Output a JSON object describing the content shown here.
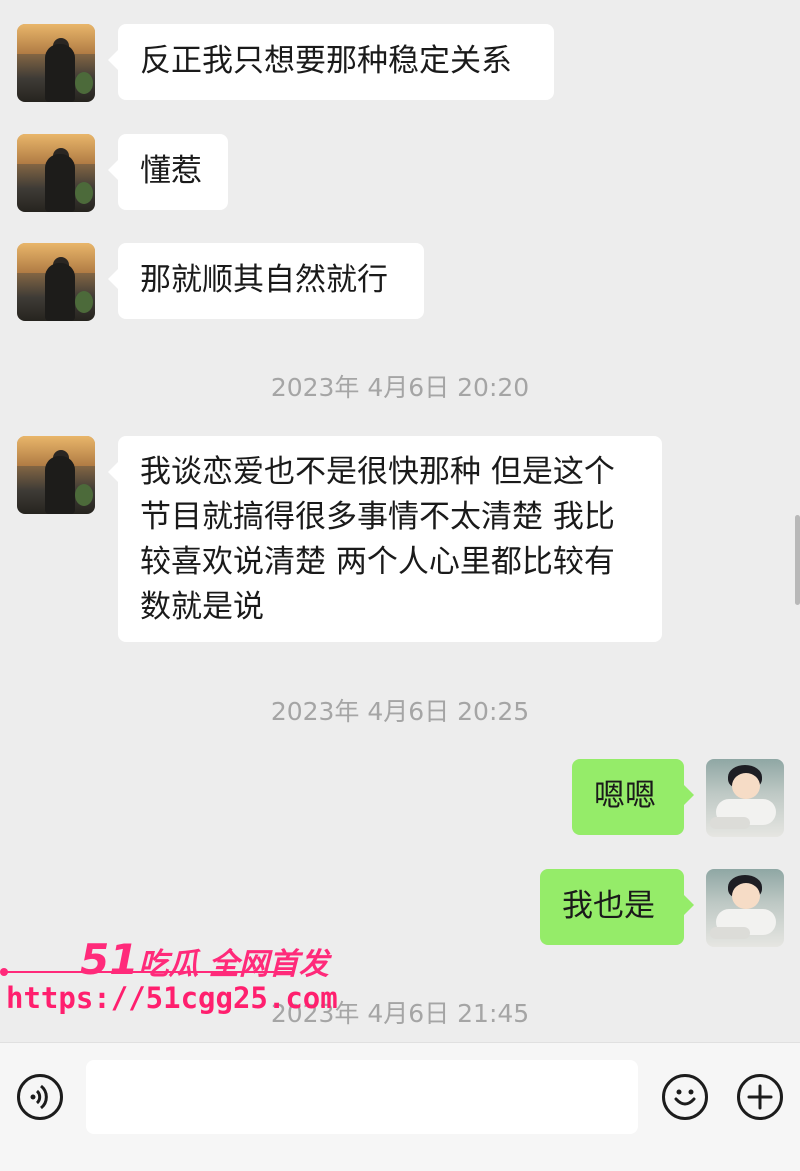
{
  "messages": [
    {
      "side": "in",
      "text": "反正我只想要那种稳定关系"
    },
    {
      "side": "in",
      "text": "懂惹"
    },
    {
      "side": "in",
      "text": "那就顺其自然就行"
    },
    {
      "side": "in",
      "lines": [
        "我谈恋爱也不是很快那种 但是这个",
        "节目就搞得很多事情不太清楚 我比",
        "较喜欢说清楚 两个人心里都比较有",
        "数就是说"
      ]
    },
    {
      "side": "out",
      "text": "嗯嗯"
    },
    {
      "side": "out",
      "text": "我也是"
    }
  ],
  "timestamps": [
    "2023年 4月6日 20:20",
    "2023年 4月6日 20:25",
    "2023年 4月6日 21:45"
  ],
  "watermark": {
    "num": "51",
    "title": "吃瓜 全网首发",
    "url": "https://51cgg25.com"
  },
  "input": {
    "value": ""
  },
  "icons": {
    "voice": "voice-icon",
    "emoji": "emoji-icon",
    "plus": "plus-icon"
  }
}
